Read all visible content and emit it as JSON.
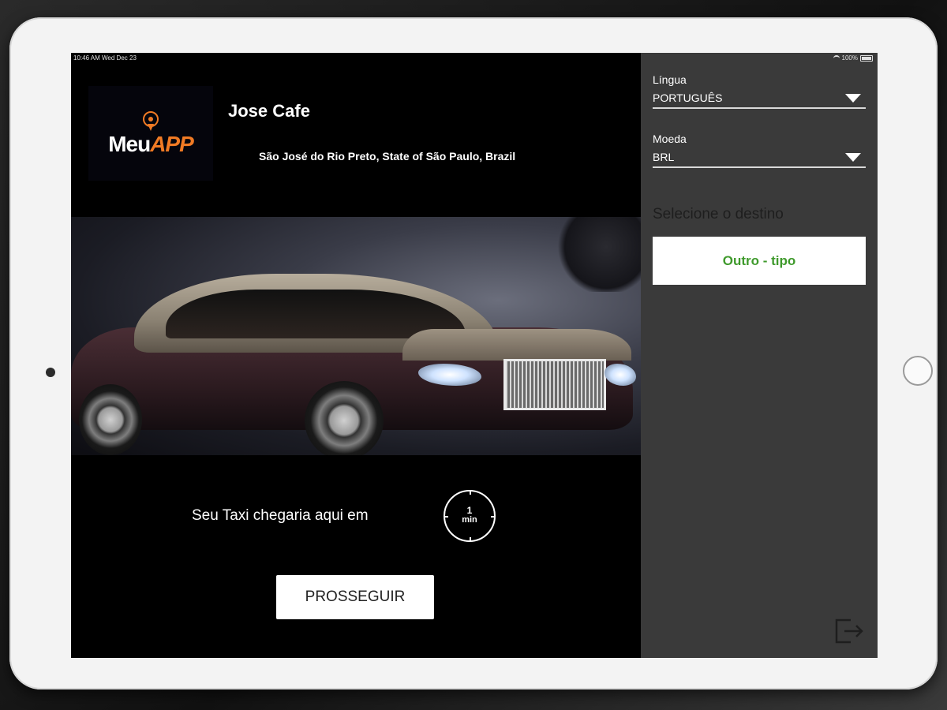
{
  "status_bar": {
    "time_date": "10:46 AM   Wed Dec 23",
    "battery": "100%"
  },
  "venue": {
    "logo_meu": "Meu",
    "logo_app": "APP",
    "name": "Jose Cafe",
    "address": "São José do Rio Preto, State of São Paulo, Brazil"
  },
  "arrival": {
    "text": "Seu Taxi chegaria aqui em",
    "minutes": "1",
    "unit": "min"
  },
  "actions": {
    "proceed_label": "PROSSEGUIR"
  },
  "settings": {
    "language_label": "Língua",
    "language_value": "PORTUGUÊS",
    "currency_label": "Moeda",
    "currency_value": "BRL"
  },
  "destination": {
    "title": "Selecione o destino",
    "options": [
      "Outro - tipo"
    ]
  },
  "colors": {
    "brand_orange": "#f07a24",
    "option_green": "#3f9a2c",
    "panel_gray": "#3a3a3a"
  },
  "icons": [
    "wifi-icon",
    "battery-icon",
    "location-pin-icon",
    "timer-icon",
    "dropdown-arrow-icon",
    "logout-icon"
  ]
}
